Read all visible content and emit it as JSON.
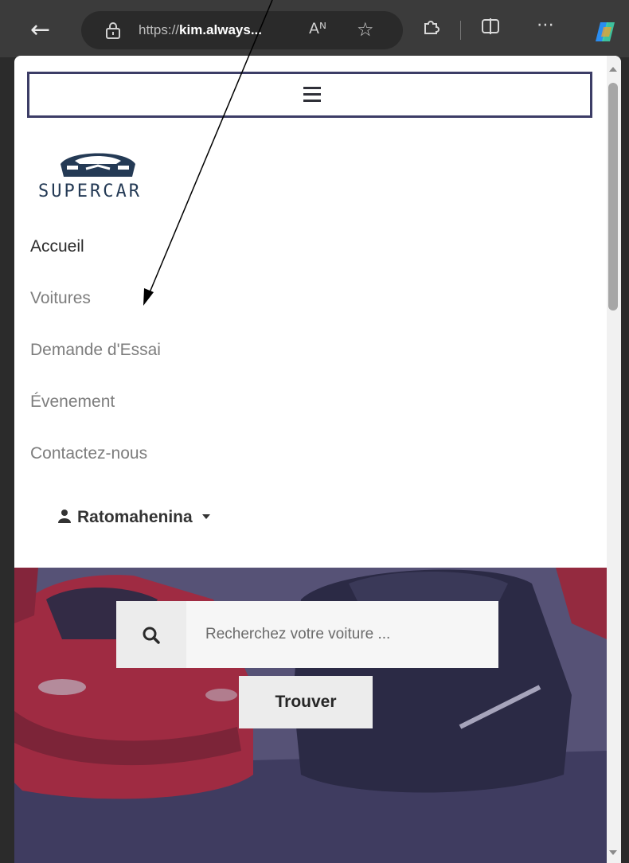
{
  "browser": {
    "url_prefix": "https://",
    "url_domain": "kim.always...",
    "read_aloud": "Aᴺ",
    "icons": [
      "back-icon",
      "lock-icon",
      "read-aloud-icon",
      "favorite-icon",
      "extensions-icon",
      "split-screen-icon",
      "more-icon",
      "copilot-icon"
    ]
  },
  "logo": {
    "text": "SUPERCAR"
  },
  "nav": {
    "items": [
      {
        "label": "Accueil",
        "active": true
      },
      {
        "label": "Voitures",
        "active": false
      },
      {
        "label": "Demande d'Essai",
        "active": false
      },
      {
        "label": "Évenement",
        "active": false
      },
      {
        "label": "Contactez-nous",
        "active": false
      }
    ],
    "user": "Ratomahenina"
  },
  "search": {
    "placeholder": "Recherchez votre voiture ...",
    "button_label": "Trouver"
  },
  "colors": {
    "nav_border": "#3c3d66",
    "logo": "#243a55",
    "hero_overlay": "#51506e"
  }
}
